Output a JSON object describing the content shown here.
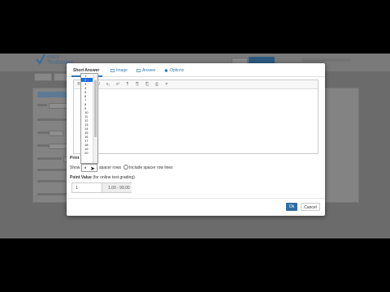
{
  "app": {
    "logo_text": "easy\nTestMaker"
  },
  "modal": {
    "tabs": [
      {
        "label": "Short Answer",
        "icon": "none"
      },
      {
        "label": "Image",
        "icon": "picture-icon"
      },
      {
        "label": "Answer",
        "icon": "picture-icon"
      },
      {
        "label": "Options",
        "icon": "info-icon"
      }
    ],
    "editor_toolbar": [
      "B",
      "I",
      "U",
      "x₂",
      "x²",
      "¶",
      "⎘",
      "⎗",
      "⎙",
      "⌗"
    ],
    "print_label": "Print",
    "show_label": "Show",
    "spacer_value": "1",
    "spacer_rows_label": "spacer rows",
    "include_label": "Include spacer row lines",
    "point_value_label": "Point Value",
    "point_value_note": "(for online test grading)",
    "point_input": "1",
    "point_range": "1.00 - 99.00",
    "ok_label": "Ok",
    "cancel_label": "Cancel"
  },
  "dropdown": {
    "options": [
      "1",
      "2",
      "3",
      "4",
      "5",
      "6",
      "7",
      "8",
      "9",
      "10",
      "11",
      "12",
      "13",
      "14",
      "15",
      "16",
      "17",
      "18",
      "19",
      "20"
    ],
    "selected": "2"
  }
}
